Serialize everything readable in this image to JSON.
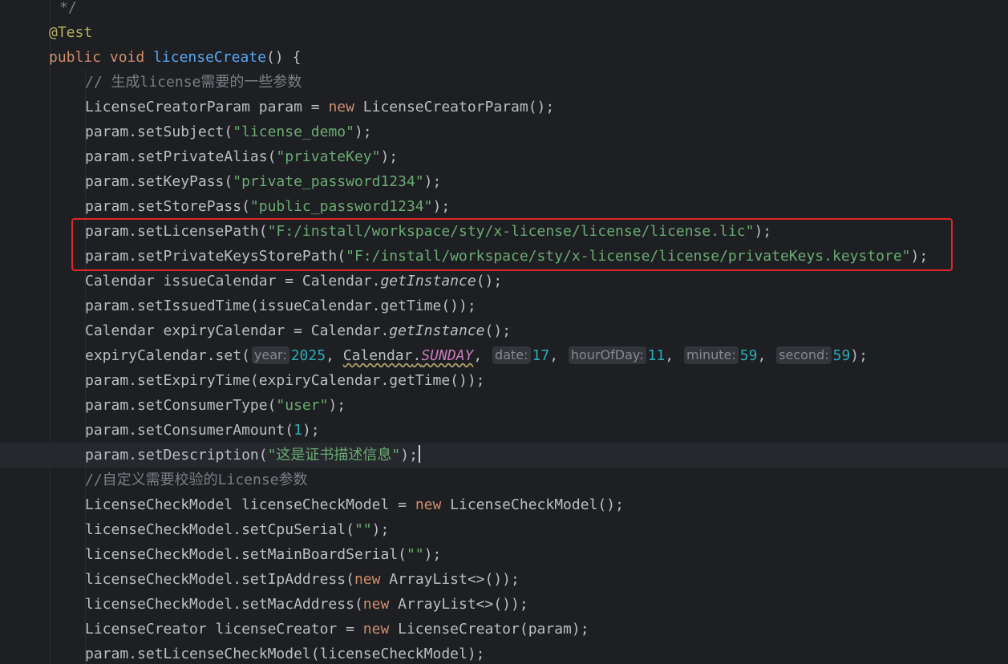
{
  "lines": {
    "comment_end": "*/",
    "annotation": "@Test",
    "decl_public": "public",
    "decl_void": "void",
    "decl_name": "licenseCreate",
    "decl_tail": "() {",
    "comment1": "// 生成license需要的一些参数",
    "l_creator_param_a": "LicenseCreatorParam param = ",
    "l_creator_param_new": "new",
    "l_creator_param_b": " LicenseCreatorParam();",
    "set_subject_a": "param.setSubject(",
    "set_subject_str": "\"license_demo\"",
    "set_private_alias_a": "param.setPrivateAlias(",
    "set_private_alias_str": "\"privateKey\"",
    "set_keypass_a": "param.setKeyPass(",
    "set_keypass_str": "\"private_password1234\"",
    "set_storepass_a": "param.setStorePass(",
    "set_storepass_str": "\"public_password1234\"",
    "set_license_path_a": "param.setLicensePath(",
    "set_license_path_str": "\"F:/install/workspace/sty/x-license/license/license.lic\"",
    "set_pks_path_a": "param.setPrivateKeysStorePath(",
    "set_pks_path_str": "\"F:/install/workspace/sty/x-license/license/privateKeys.keystore\"",
    "issue_cal_a": "Calendar issueCalendar = Calendar.",
    "issue_cal_m": "getInstance",
    "issue_cal_b": "();",
    "set_issued": "param.setIssuedTime(issueCalendar.getTime());",
    "expiry_cal_a": "Calendar expiryCalendar = Calendar.",
    "expiry_cal_m": "getInstance",
    "expiry_cal_b": "();",
    "expiry_set_a": "expiryCalendar.set(",
    "hint_year": "year:",
    "val_year": "2025",
    "cal_class": "Calendar",
    "cal_dot": ".",
    "cal_sunday": "SUNDAY",
    "hint_date": "date:",
    "val_date": "17",
    "hint_hour": "hourOfDay:",
    "val_hour": "11",
    "hint_minute": "minute:",
    "val_minute": "59",
    "hint_second": "second:",
    "val_second": "59",
    "set_expiry": "param.setExpiryTime(expiryCalendar.getTime());",
    "set_consumer_type_a": "param.setConsumerType(",
    "set_consumer_type_str": "\"user\"",
    "set_consumer_amount_a": "param.setConsumerAmount(",
    "set_consumer_amount_num": "1",
    "set_description_a": "param.setDescription(",
    "set_description_str": "\"这是证书描述信息\"",
    "comment2": "//自定义需要校验的License参数",
    "check_model_a": "LicenseCheckModel licenseCheckModel = ",
    "check_model_new": "new",
    "check_model_b": " LicenseCheckModel();",
    "set_cpu_a": "licenseCheckModel.setCpuSerial(",
    "set_cpu_str": "\"\"",
    "set_mainboard_a": "licenseCheckModel.setMainBoardSerial(",
    "set_mainboard_str": "\"\"",
    "set_ip_a": "licenseCheckModel.setIpAddress(",
    "set_ip_new": "new",
    "set_ip_b": " ArrayList<>());",
    "set_mac_a": "licenseCheckModel.setMacAddress(",
    "set_mac_new": "new",
    "set_mac_b": " ArrayList<>());",
    "creator_a": "LicenseCreator licenseCreator = ",
    "creator_new": "new",
    "creator_b": " LicenseCreator(param);",
    "set_check_model": "param.setLicenseCheckModel(licenseCheckModel);",
    "semi": ";",
    "rparen": ")",
    "rparen_semi": ");",
    "comma": ", "
  },
  "colors": {
    "background": "#1e1f22",
    "keyword": "#cf8e6d",
    "method_decl": "#56a8f5",
    "string": "#6aab73",
    "number": "#2aacb8",
    "comment": "#7a7e85",
    "annotation": "#b3ae60",
    "constant": "#c77dbb",
    "highlight_box": "#e0262b"
  }
}
